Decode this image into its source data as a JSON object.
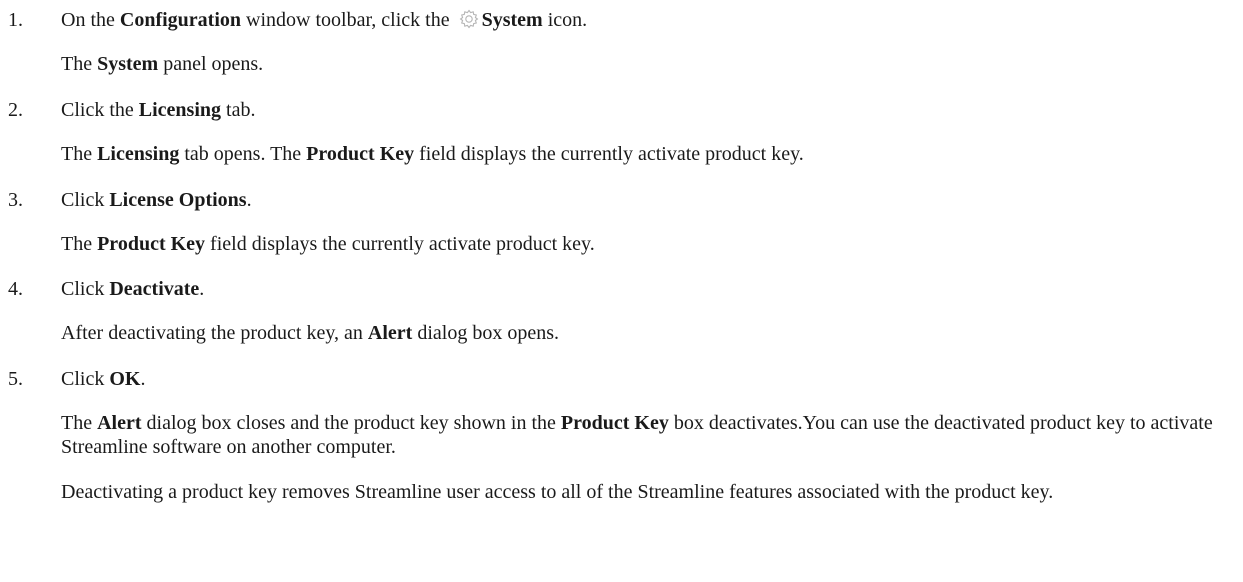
{
  "steps": [
    {
      "number": "1.",
      "instruction": {
        "t1": "On the ",
        "b1": "Configuration",
        "t2": " window toolbar, click the ",
        "icon": "gear-icon",
        "b2": "System",
        "t3": " icon."
      },
      "result": {
        "t1": "The ",
        "b1": "System",
        "t2": " panel opens."
      }
    },
    {
      "number": "2.",
      "instruction": {
        "t1": "Click the ",
        "b1": "Licensing",
        "t2": " tab."
      },
      "result": {
        "t1": "The ",
        "b1": "Licensing",
        "t2": " tab opens. The ",
        "b2": "Product Key",
        "t3": " field displays the currently activate product key."
      }
    },
    {
      "number": "3.",
      "instruction": {
        "t1": "Click ",
        "b1": "License Options",
        "t2": "."
      },
      "result": {
        "t1": "The ",
        "b1": "Product Key",
        "t2": " field displays the currently activate product key."
      }
    },
    {
      "number": "4.",
      "instruction": {
        "t1": "Click ",
        "b1": "Deactivate",
        "t2": "."
      },
      "result": {
        "t1": "After deactivating the product key, an ",
        "b1": "Alert",
        "t2": " dialog box opens."
      }
    },
    {
      "number": "5.",
      "instruction": {
        "t1": "Click ",
        "b1": "OK",
        "t2": "."
      },
      "result": {
        "t1": "The ",
        "b1": "Alert",
        "t2": " dialog box closes and the product key shown in the ",
        "b2": "Product Key",
        "t3": " box deactivates.You can use the deactivated product key to activate Streamline software on another computer."
      },
      "note": "Deactivating a product key removes Streamline user access to all of the Streamline features associated with the product key."
    }
  ]
}
